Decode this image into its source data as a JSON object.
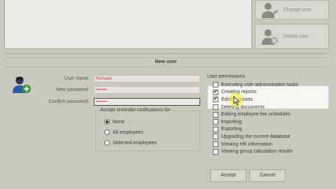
{
  "side_buttons": {
    "change_user": {
      "label": "Change user",
      "icon": "user-edit-icon"
    },
    "delete_user": {
      "label": "Delete user",
      "icon": "user-delete-icon"
    }
  },
  "section": {
    "title": "New user"
  },
  "form": {
    "user_name": {
      "label": "User name",
      "value": "Richard"
    },
    "new_password": {
      "label": "New password",
      "value": "•••••••"
    },
    "confirm_password": {
      "label": "Confirm password",
      "value": "•••••••"
    }
  },
  "reminders": {
    "title": "Accept reminder notifications for",
    "options": [
      {
        "label": "None",
        "selected": true
      },
      {
        "label": "All employees",
        "selected": false
      },
      {
        "label": "Selected employees",
        "selected": false
      }
    ]
  },
  "permissions": {
    "title": "User permissions",
    "items": [
      {
        "label": "Executing user administration tasks",
        "checked": false
      },
      {
        "label": "Creating reports",
        "checked": true
      },
      {
        "label": "Editing reports",
        "checked": true
      },
      {
        "label": "Deleting documents",
        "checked": false
      },
      {
        "label": "Editing employee fee schedules",
        "checked": false
      },
      {
        "label": "Importing",
        "checked": false
      },
      {
        "label": "Exporting",
        "checked": false
      },
      {
        "label": "Upgrading the current database",
        "checked": false
      },
      {
        "label": "Viewing HR information",
        "checked": false
      },
      {
        "label": "Viewing group calculation results",
        "checked": false
      }
    ]
  },
  "actions": {
    "accept": "Accept",
    "cancel": "Cancel"
  },
  "colors": {
    "background": "#c9c9bd",
    "field_text": "#cf3a3a",
    "highlight": "#f7f7f2"
  }
}
